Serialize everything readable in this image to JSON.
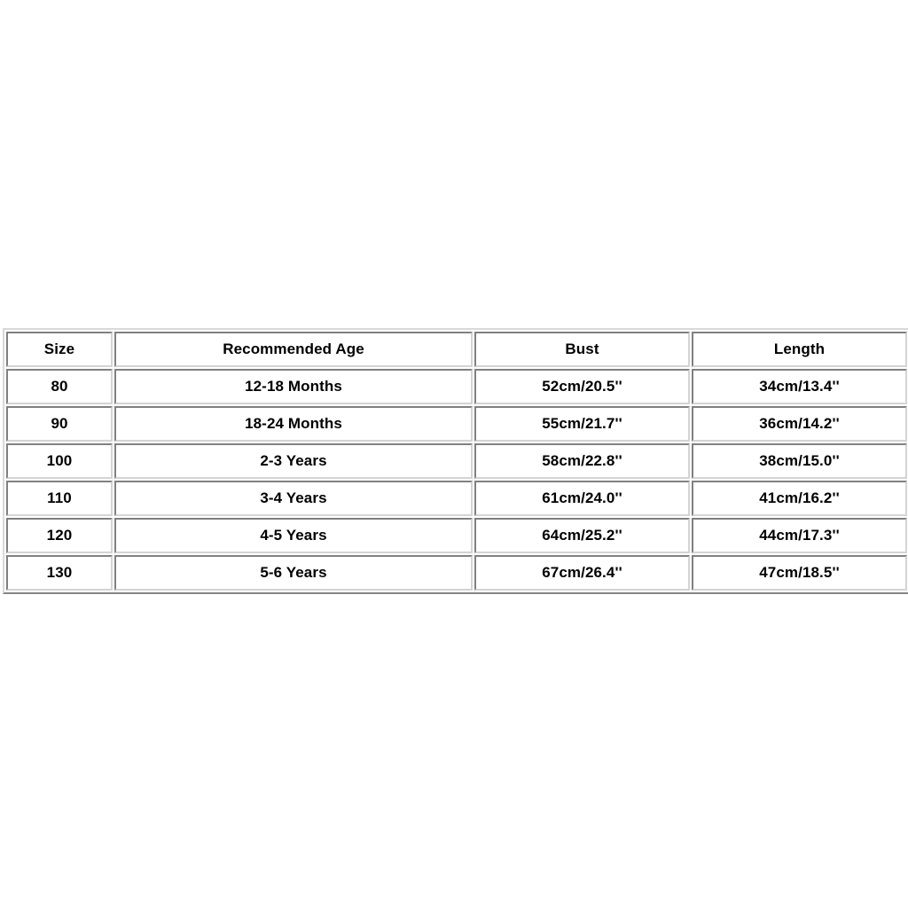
{
  "page": {
    "background_color": "#ffffff",
    "text_color": "#000000",
    "border_color": "#d4d4d4"
  },
  "size_chart": {
    "columns": [
      {
        "key": "size",
        "label": "Size"
      },
      {
        "key": "age",
        "label": "Recommended Age"
      },
      {
        "key": "bust",
        "label": "Bust"
      },
      {
        "key": "length",
        "label": "Length"
      }
    ],
    "rows": [
      {
        "size": "80",
        "age": "12-18 Months",
        "bust": "52cm/20.5''",
        "length": "34cm/13.4''"
      },
      {
        "size": "90",
        "age": "18-24 Months",
        "bust": "55cm/21.7''",
        "length": "36cm/14.2''"
      },
      {
        "size": "100",
        "age": "2-3 Years",
        "bust": "58cm/22.8''",
        "length": "38cm/15.0''"
      },
      {
        "size": "110",
        "age": "3-4 Years",
        "bust": "61cm/24.0''",
        "length": "41cm/16.2''"
      },
      {
        "size": "120",
        "age": "4-5 Years",
        "bust": "64cm/25.2''",
        "length": "44cm/17.3''"
      },
      {
        "size": "130",
        "age": "5-6 Years",
        "bust": "67cm/26.4''",
        "length": "47cm/18.5''"
      }
    ]
  }
}
